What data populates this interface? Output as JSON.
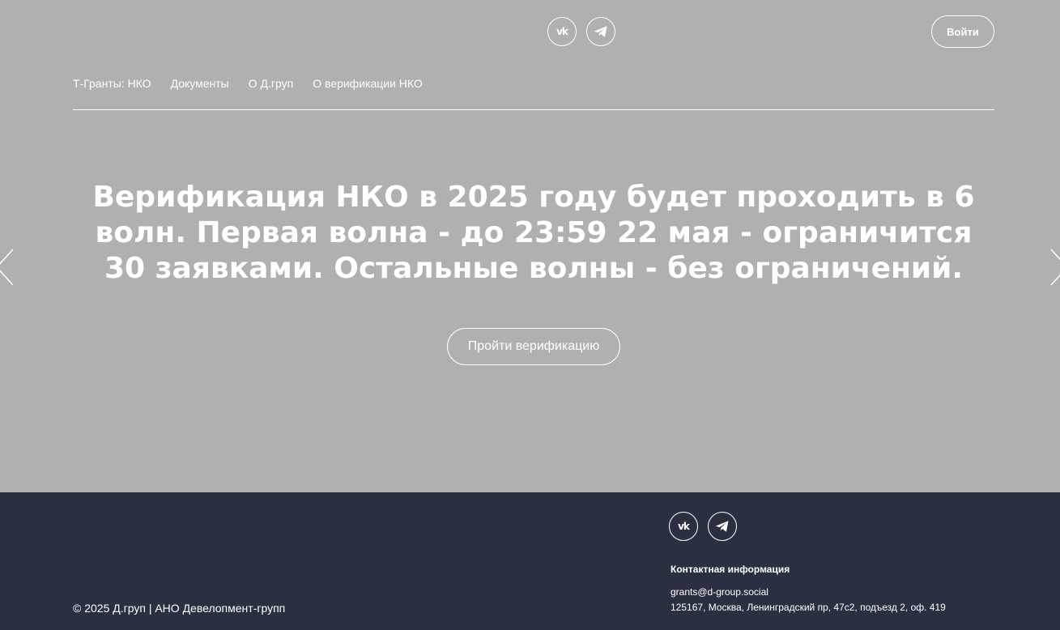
{
  "header": {
    "social": [
      {
        "icon": "vk-icon",
        "glyph": "vk"
      },
      {
        "icon": "telegram-icon"
      }
    ],
    "login_label": "Войти",
    "nav": [
      {
        "label": "Т-Гранты: НКО"
      },
      {
        "label": "Документы"
      },
      {
        "label": "О Д.груп"
      },
      {
        "label": "О верификации НКО"
      }
    ]
  },
  "hero": {
    "headline": "Верификация НКО в 2025 году будет проходить в 6 волн. Первая волна - до 23:59 22 мая - ограничится 30 заявками. Остальные волны - без ограничений.",
    "cta_label": "Пройти верификацию",
    "prev_icon": "chevron-left-icon",
    "next_icon": "chevron-right-icon"
  },
  "footer": {
    "social": [
      {
        "icon": "vk-icon",
        "glyph": "vk"
      },
      {
        "icon": "telegram-icon"
      }
    ],
    "copyright": "© 2025 Д.груп | АНО Девелопмент-групп",
    "contact_heading": "Контактная информация",
    "email": "grants@d-group.social",
    "address": "125167, Москва, Ленинградский пр, 47с2, подъезд 2, оф. 419"
  },
  "colors": {
    "hero_bg": "#b0b0b0",
    "footer_bg": "#2a3042",
    "text": "#ffffff"
  }
}
